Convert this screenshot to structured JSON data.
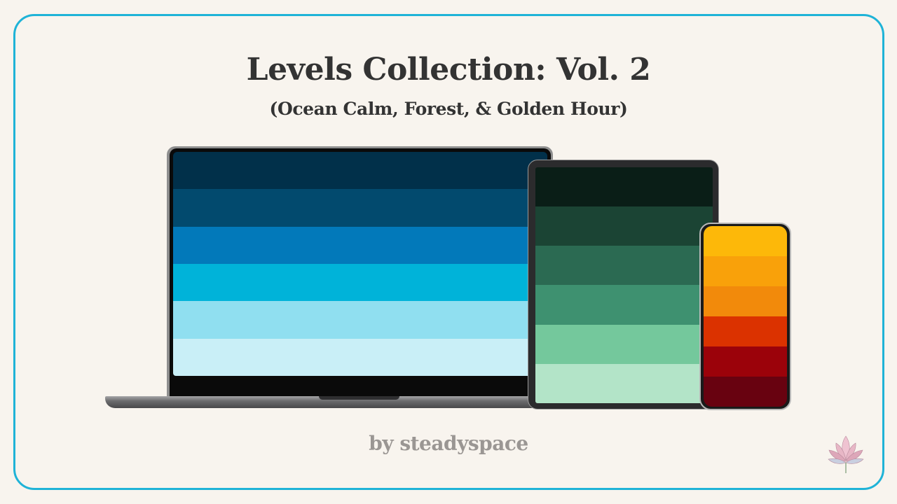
{
  "header": {
    "title": "Levels Collection: Vol. 2",
    "subtitle": "(Ocean Calm, Forest, & Golden Hour)"
  },
  "footer": {
    "byline": "by steadyspace",
    "logo_icon": "lotus-icon"
  },
  "accent_color": "#1fb3d7",
  "devices": {
    "laptop": {
      "icon": "laptop-icon",
      "palette": [
        "#01304a",
        "#024a6e",
        "#0279ba",
        "#00b3d9",
        "#90dff0",
        "#c9eff7"
      ]
    },
    "tablet": {
      "icon": "tablet-icon",
      "palette": [
        "#0a1e17",
        "#1b4434",
        "#2b6a52",
        "#3e9170",
        "#74c89c",
        "#b3e4c8"
      ]
    },
    "phone": {
      "icon": "phone-icon",
      "palette": [
        "#fdb809",
        "#f9a10a",
        "#f28a0b",
        "#db3200",
        "#9b020a",
        "#680210"
      ]
    }
  }
}
